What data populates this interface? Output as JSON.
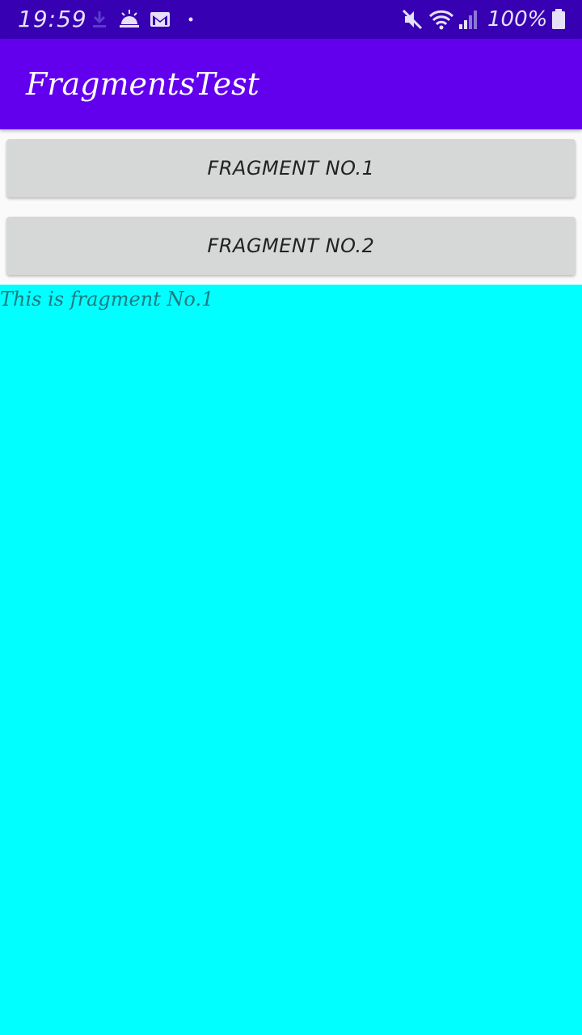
{
  "status_bar": {
    "time": "19:59",
    "battery_percent": "100%",
    "icons": [
      "download-icon",
      "weather-sunrise-icon",
      "gmail-icon",
      "notification-dot-icon",
      "mute-icon",
      "wifi-icon",
      "signal-icon",
      "battery-icon"
    ],
    "background_color": "#3700b3"
  },
  "app_bar": {
    "title": "FragmentsTest",
    "background_color": "#6200ee"
  },
  "buttons": {
    "fragment1_label": "FRAGMENT NO.1",
    "fragment2_label": "FRAGMENT NO.2"
  },
  "fragment": {
    "text": "This is fragment No.1",
    "background_color": "#00ffff"
  }
}
